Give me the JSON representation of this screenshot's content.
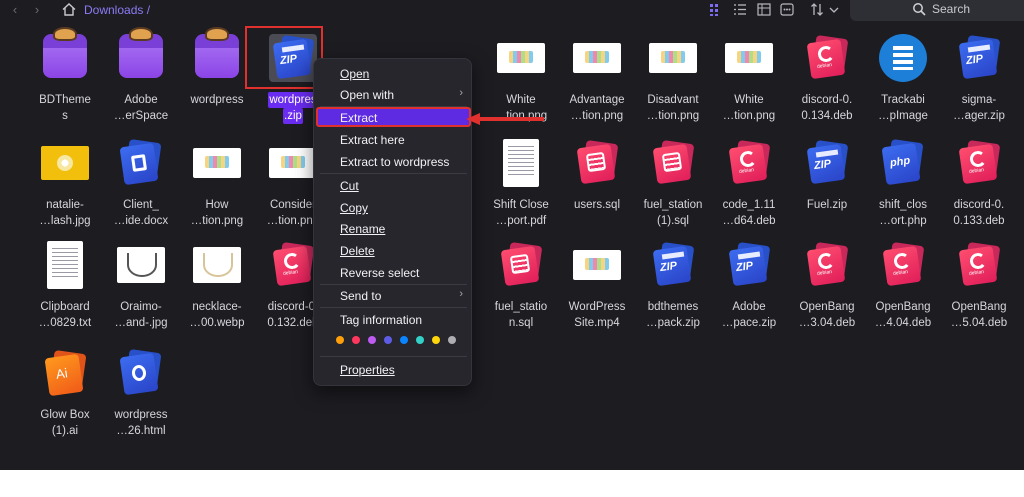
{
  "toolbar": {
    "back_glyph": "‹",
    "forward_glyph": "›",
    "breadcrumb": "Downloads",
    "breadcrumb_sep": "/",
    "search_placeholder": "Search"
  },
  "files": [
    {
      "id": "bdthemes",
      "line1": "BDTheme",
      "line2": "s",
      "thumb": "folder"
    },
    {
      "id": "adobe-folder",
      "line1": "Adobe",
      "line2": "…erSpace",
      "thumb": "folder"
    },
    {
      "id": "wordpress-folder",
      "line1": "wordpress",
      "line2": "",
      "thumb": "folder"
    },
    {
      "id": "wordpress-zip",
      "line1": "wordpres",
      "line2": ".zip",
      "thumb": "zip",
      "selected": true
    },
    {
      "id": "white-tion-1",
      "line1": "White",
      "line2": "…tion.png",
      "thumb": "img-wide"
    },
    {
      "id": "advantage",
      "line1": "Advantage",
      "line2": "…tion.png",
      "thumb": "img-wide"
    },
    {
      "id": "disadvant",
      "line1": "Disadvant",
      "line2": "…tion.png",
      "thumb": "img-wide"
    },
    {
      "id": "white-tion-2",
      "line1": "White",
      "line2": "…tion.png",
      "thumb": "img-wide"
    },
    {
      "id": "discord-134",
      "line1": "discord-0.",
      "line2": "0.134.deb",
      "thumb": "deb"
    },
    {
      "id": "trackabi",
      "line1": "Trackabi",
      "line2": "…pImage",
      "thumb": "trackabi"
    },
    {
      "id": "sigma",
      "line1": "sigma-",
      "line2": "…ager.zip",
      "thumb": "zip"
    },
    {
      "id": "natalie",
      "line1": "natalie-",
      "line2": "…lash.jpg",
      "thumb": "img-jpg"
    },
    {
      "id": "client",
      "line1": "Client_",
      "line2": "…ide.docx",
      "thumb": "doc"
    },
    {
      "id": "how",
      "line1": "How",
      "line2": "…tion.png",
      "thumb": "img-wide"
    },
    {
      "id": "consider",
      "line1": "Consider",
      "line2": "…tion.png",
      "thumb": "img-wide"
    },
    {
      "id": "shift-close",
      "line1": "Shift Close",
      "line2": "…port.pdf",
      "thumb": "img-doc"
    },
    {
      "id": "users",
      "line1": "users.sql",
      "line2": "",
      "thumb": "sql"
    },
    {
      "id": "fuel-station-1",
      "line1": "fuel_station",
      "line2": " (1).sql",
      "thumb": "sql"
    },
    {
      "id": "code",
      "line1": "code_1.11",
      "line2": "…d64.deb",
      "thumb": "deb"
    },
    {
      "id": "fuel-zip",
      "line1": "Fuel.zip",
      "line2": "",
      "thumb": "zip"
    },
    {
      "id": "shift-clos-php",
      "line1": "shift_clos",
      "line2": "…ort.php",
      "thumb": "php"
    },
    {
      "id": "discord-133",
      "line1": "discord-0.",
      "line2": "0.133.deb",
      "thumb": "deb"
    },
    {
      "id": "clipboard",
      "line1": "Clipboard",
      "line2": "…0829.txt",
      "thumb": "img-doc"
    },
    {
      "id": "oraimo",
      "line1": "Oraimo-",
      "line2": "…and-.jpg",
      "thumb": "img-head"
    },
    {
      "id": "necklace",
      "line1": "necklace-",
      "line2": "…00.webp",
      "thumb": "img-head-cream"
    },
    {
      "id": "discord-132",
      "line1": "discord-0.",
      "line2": "0.132.deb",
      "thumb": "deb"
    },
    {
      "id": "fuel-station",
      "line1": "fuel_statio",
      "line2": "n.sql",
      "thumb": "sql"
    },
    {
      "id": "wp-site",
      "line1": "WordPress",
      "line2": "Site.mp4",
      "thumb": "img-wide"
    },
    {
      "id": "bdthemes-zip",
      "line1": "bdthemes",
      "line2": "…pack.zip",
      "thumb": "zip"
    },
    {
      "id": "adobe-zip",
      "line1": "Adobe",
      "line2": "…pace.zip",
      "thumb": "zip"
    },
    {
      "id": "openbang-3",
      "line1": "OpenBang",
      "line2": "…3.04.deb",
      "thumb": "deb"
    },
    {
      "id": "openbang-4",
      "line1": "OpenBang",
      "line2": "…4.04.deb",
      "thumb": "deb"
    },
    {
      "id": "openbang-5",
      "line1": "OpenBang",
      "line2": "…5.04.deb",
      "thumb": "deb"
    },
    {
      "id": "glowbox",
      "line1": "Glow Box",
      "line2": "(1).ai",
      "thumb": "ai"
    },
    {
      "id": "wordpress-html",
      "line1": "wordpress",
      "line2": "…26.html",
      "thumb": "html"
    }
  ],
  "zip_label": "ZIP",
  "deb_label": "debian",
  "php_label": "php",
  "ai_label": "Ai",
  "context_menu": {
    "open": "Open",
    "open_with": "Open with",
    "extract": "Extract",
    "extract_here": "Extract here",
    "extract_to": "Extract to wordpress",
    "cut": "Cut",
    "copy": "Copy",
    "rename": "Rename",
    "delete": "Delete",
    "reverse_select": "Reverse select",
    "send_to": "Send to",
    "tag_information": "Tag information",
    "properties": "Properties",
    "submenu_glyph": "›",
    "tag_colors": [
      "#ff9f0a",
      "#ff375f",
      "#bf5af2",
      "#5e5ce6",
      "#0a84ff",
      "#32d2c8",
      "#ffd60a",
      "#aeaeb2"
    ]
  },
  "colors": {
    "background": "#1c1c21",
    "accent": "#6a2cf0",
    "highlight_outline": "#e0312e",
    "breadcrumb": "#8b7cf6"
  }
}
